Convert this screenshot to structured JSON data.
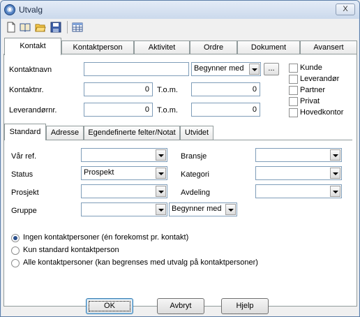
{
  "window": {
    "title": "Utvalg",
    "close_label": "X"
  },
  "toolbar": {
    "items": [
      {
        "name": "new-document-icon"
      },
      {
        "name": "open-book-icon"
      },
      {
        "name": "open-folder-icon"
      },
      {
        "name": "save-icon"
      },
      {
        "name": "table-view-icon"
      }
    ]
  },
  "tabs": {
    "items": [
      {
        "label": "Kontakt",
        "active": true
      },
      {
        "label": "Kontaktperson"
      },
      {
        "label": "Aktivitet"
      },
      {
        "label": "Ordre"
      },
      {
        "label": "Dokument"
      },
      {
        "label": "Avansert"
      }
    ]
  },
  "contact": {
    "name_label": "Kontaktnavn",
    "name_value": "",
    "name_match": "Begynner med",
    "ellipsis": "...",
    "nr_label": "Kontaktnr.",
    "nr_from": "0",
    "nr_tom_label": "T.o.m.",
    "nr_to": "0",
    "lev_label": "Leverandørnr.",
    "lev_from": "0",
    "lev_tom_label": "T.o.m.",
    "lev_to": "0"
  },
  "types": [
    {
      "label": "Kunde",
      "checked": false
    },
    {
      "label": "Leverandør",
      "checked": false
    },
    {
      "label": "Partner",
      "checked": false
    },
    {
      "label": "Privat",
      "checked": false
    },
    {
      "label": "Hovedkontor",
      "checked": false
    }
  ],
  "subtabs": {
    "items": [
      {
        "label": "Standard",
        "active": true
      },
      {
        "label": "Adresse"
      },
      {
        "label": "Egendefinerte felter/Notat"
      },
      {
        "label": "Utvidet"
      }
    ]
  },
  "standard": {
    "var_ref_label": "Vår ref.",
    "var_ref_value": "",
    "status_label": "Status",
    "status_value": "Prospekt",
    "prosjekt_label": "Prosjekt",
    "prosjekt_value": "",
    "gruppe_label": "Gruppe",
    "gruppe_value": "",
    "gruppe_match": "Begynner med",
    "bransje_label": "Bransje",
    "bransje_value": "",
    "kategori_label": "Kategori",
    "kategori_value": "",
    "avdeling_label": "Avdeling",
    "avdeling_value": ""
  },
  "radios": [
    {
      "label": "Ingen kontaktpersoner (én forekomst pr. kontakt)",
      "selected": true
    },
    {
      "label": "Kun standard kontaktperson",
      "selected": false
    },
    {
      "label": "Alle kontaktpersoner (kan begrenses med utvalg på kontaktpersoner)",
      "selected": false
    }
  ],
  "buttons": {
    "ok": "OK",
    "cancel": "Avbryt",
    "help": "Hjelp"
  }
}
